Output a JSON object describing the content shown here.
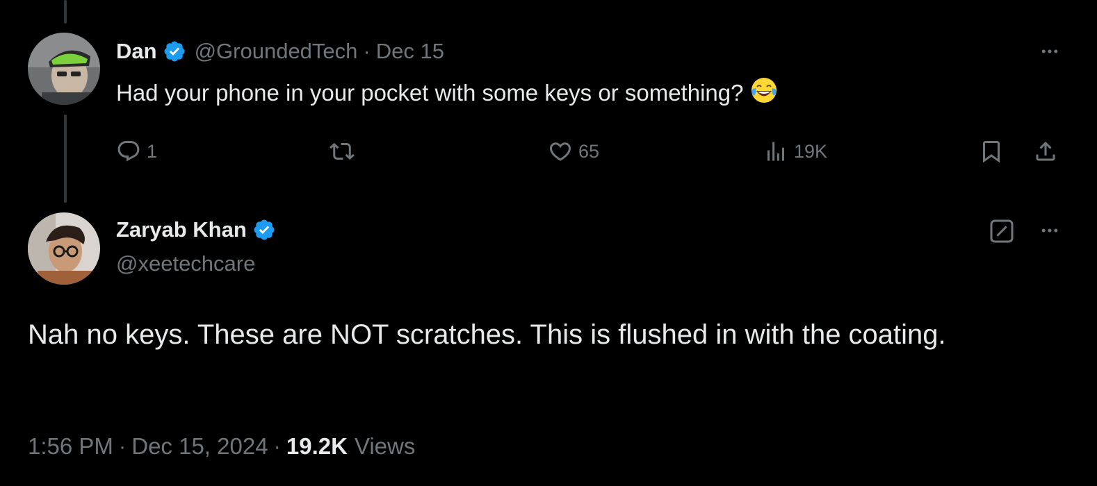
{
  "reply_tweet": {
    "author_name": "Dan",
    "handle": "@GroundedTech",
    "separator": "·",
    "date": "Dec 15",
    "text": "Had your phone in your pocket with some keys or something?",
    "emoji": "face-with-tears-of-joy",
    "actions": {
      "replies": "1",
      "likes": "65",
      "views": "19K"
    }
  },
  "main_tweet": {
    "author_name": "Zaryab Khan",
    "handle": "@xeetechcare",
    "text": "Nah no keys. These are NOT scratches. This is flushed in with the coating.",
    "time": "1:56 PM",
    "separator": "·",
    "date": "Dec 15, 2024",
    "views_count": "19.2K",
    "views_label": "Views"
  },
  "colors": {
    "background": "#000000",
    "text_primary": "#e7e9ea",
    "text_secondary": "#71767b",
    "verified_blue": "#1d9bf0",
    "thread_line": "#333639"
  },
  "icons": [
    "verified-badge-icon",
    "more-icon",
    "reply-icon",
    "retweet-icon",
    "like-icon",
    "views-icon",
    "bookmark-icon",
    "share-icon",
    "grok-icon"
  ]
}
